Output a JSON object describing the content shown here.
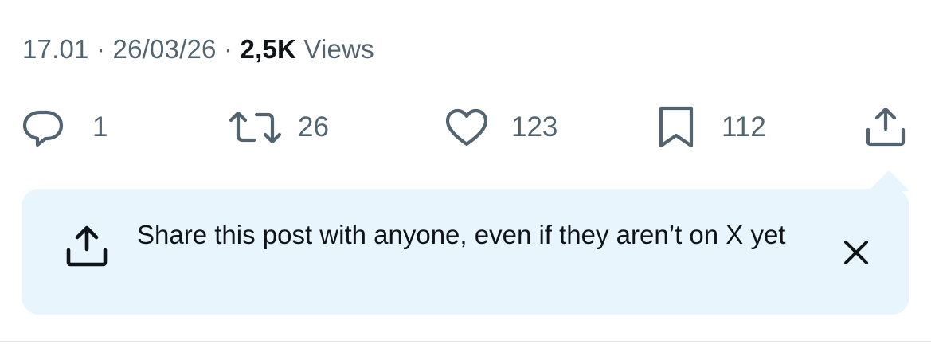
{
  "meta": {
    "time": "17.01",
    "separator": " · ",
    "date": "26/03/26",
    "views_count": "2,5K",
    "views_label": " Views"
  },
  "actions": {
    "reply": {
      "icon": "reply-icon",
      "count": "1"
    },
    "repost": {
      "icon": "repost-icon",
      "count": "26"
    },
    "like": {
      "icon": "heart-icon",
      "count": "123"
    },
    "bookmark": {
      "icon": "bookmark-icon",
      "count": "112"
    },
    "share": {
      "icon": "share-icon"
    }
  },
  "share_tooltip": {
    "icon": "share-icon",
    "message": "Share this post with anyone, even if they aren’t on X yet",
    "close_icon": "close-icon"
  },
  "colors": {
    "text_secondary": "#536471",
    "text_primary": "#0f1419",
    "tooltip_bg": "#e8f5fd",
    "divider": "#dfe3e6"
  }
}
